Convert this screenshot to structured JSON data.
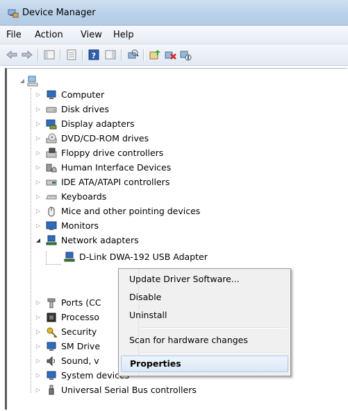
{
  "window": {
    "title": "Device Manager"
  },
  "menu": [
    "File",
    "Action",
    "View",
    "Help"
  ],
  "toolbar": [
    "back-icon",
    "forward-icon",
    "show-hide-console-tree-icon",
    "properties-icon",
    "help-icon",
    "action-pane-icon",
    "scan-hardware-icon",
    "update-driver-icon",
    "uninstall-icon",
    "disable-icon"
  ],
  "tree": {
    "root_label": "",
    "categories": [
      {
        "label": "Computer",
        "icon": "computer-icon"
      },
      {
        "label": "Disk drives",
        "icon": "disk-drive-icon"
      },
      {
        "label": "Display adapters",
        "icon": "display-adapter-icon"
      },
      {
        "label": "DVD/CD-ROM drives",
        "icon": "dvd-drive-icon"
      },
      {
        "label": "Floppy drive controllers",
        "icon": "floppy-controller-icon"
      },
      {
        "label": "Human Interface Devices",
        "icon": "hid-icon"
      },
      {
        "label": "IDE ATA/ATAPI controllers",
        "icon": "ide-controller-icon"
      },
      {
        "label": "Keyboards",
        "icon": "keyboard-icon"
      },
      {
        "label": "Mice and other pointing devices",
        "icon": "mouse-icon"
      },
      {
        "label": "Monitors",
        "icon": "monitor-icon"
      },
      {
        "label": "Network adapters",
        "icon": "network-adapter-icon",
        "expanded": true
      },
      {
        "label": "D-Link DWA-192 USB Adapter",
        "icon": "network-adapter-icon",
        "child": true
      },
      {
        "label": "Ports (CC",
        "icon": "port-icon"
      },
      {
        "label": "Processo",
        "icon": "processor-icon"
      },
      {
        "label": "Security",
        "icon": "security-icon"
      },
      {
        "label": "SM Drive",
        "icon": "sm-driver-icon"
      },
      {
        "label": "Sound, v",
        "icon": "sound-icon"
      },
      {
        "label": "System devices",
        "icon": "system-device-icon"
      },
      {
        "label": "Universal Serial Bus controllers",
        "icon": "usb-icon"
      }
    ]
  },
  "context_menu": {
    "items": [
      {
        "label": "Update Driver Software..."
      },
      {
        "label": "Disable"
      },
      {
        "label": "Uninstall"
      },
      {
        "label": "Scan for hardware changes"
      },
      {
        "label": "Properties",
        "bold": true,
        "hover": true
      }
    ]
  }
}
